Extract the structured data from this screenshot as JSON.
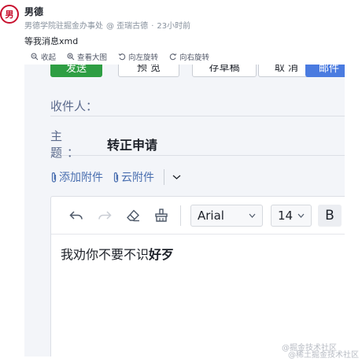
{
  "post": {
    "author_name": "男德",
    "avatar_text": "男",
    "meta": {
      "school": "男德学院驻掘金办事处",
      "at": "@ 歪瑞古德",
      "dot": "·",
      "time": "23小时前"
    },
    "text": "等我消息xmd"
  },
  "viewer_toolbar": {
    "collapse": "收起",
    "view_large": "查看大图",
    "rotate_left": "向左旋转",
    "rotate_right": "向右旋转"
  },
  "mail": {
    "buttons": {
      "send": "发送",
      "preview": "预 览",
      "draft": "存草稿",
      "cancel": "取 消",
      "blue": "邮件"
    },
    "recipient_label": "收件人：",
    "subject_label": "主 题：",
    "subject_value": "转正申请",
    "attachments": {
      "add": "添加附件",
      "cloud": "云附件"
    },
    "editor": {
      "font": "Arial",
      "size": "14",
      "bold": "B",
      "body_normal": "我劝你不要不识",
      "body_bold": "好歹"
    }
  },
  "watermarks": {
    "juejin": "@掘金技术社区",
    "xitu": "@稀土掘金技术社区"
  },
  "colors": {
    "send_button": "#2e9e43",
    "blue_button": "#4a7be0",
    "label": "#5b6a8c",
    "link": "#4a6fb0"
  }
}
